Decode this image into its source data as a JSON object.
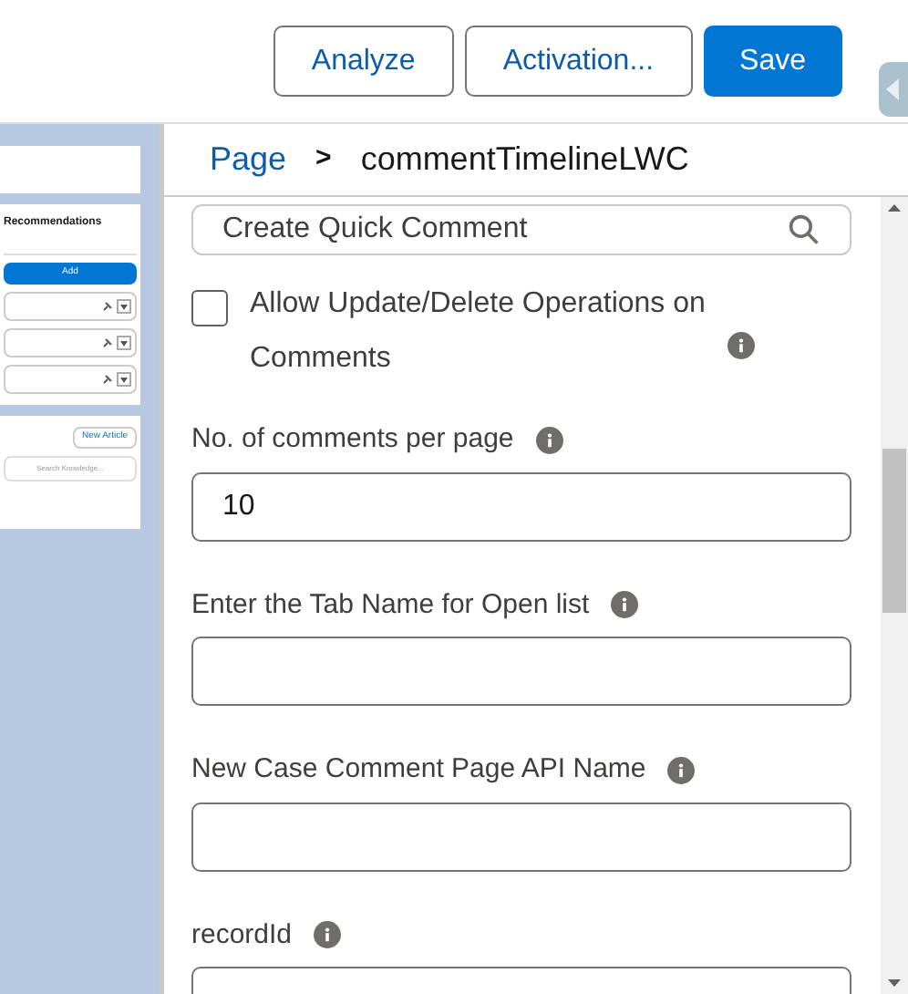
{
  "toolbar": {
    "buttons": [
      {
        "label": "Analyze",
        "kind": "outline"
      },
      {
        "label": "Activation...",
        "kind": "outline"
      },
      {
        "label": "Save",
        "kind": "brand"
      }
    ]
  },
  "preview": {
    "title": "Recommendations",
    "add_button": "Add",
    "new_article_button": "New Article",
    "search_placeholder": "Search Knowledge..."
  },
  "breadcrumb": {
    "parent": "Page",
    "separator": ">",
    "current": "commentTimelineLWC"
  },
  "properties": [
    {
      "kind": "lookup",
      "value": "Create Quick Comment"
    },
    {
      "kind": "checkbox",
      "label": "Allow Update/Delete Operations on Comments",
      "checked": false
    },
    {
      "kind": "text",
      "label": "No. of comments per page",
      "value": "10"
    },
    {
      "kind": "text",
      "label": "Enter the Tab Name for Open list"
    },
    {
      "kind": "text",
      "label": "New Case Comment Page API Name"
    },
    {
      "kind": "text",
      "label": "recordId"
    }
  ]
}
